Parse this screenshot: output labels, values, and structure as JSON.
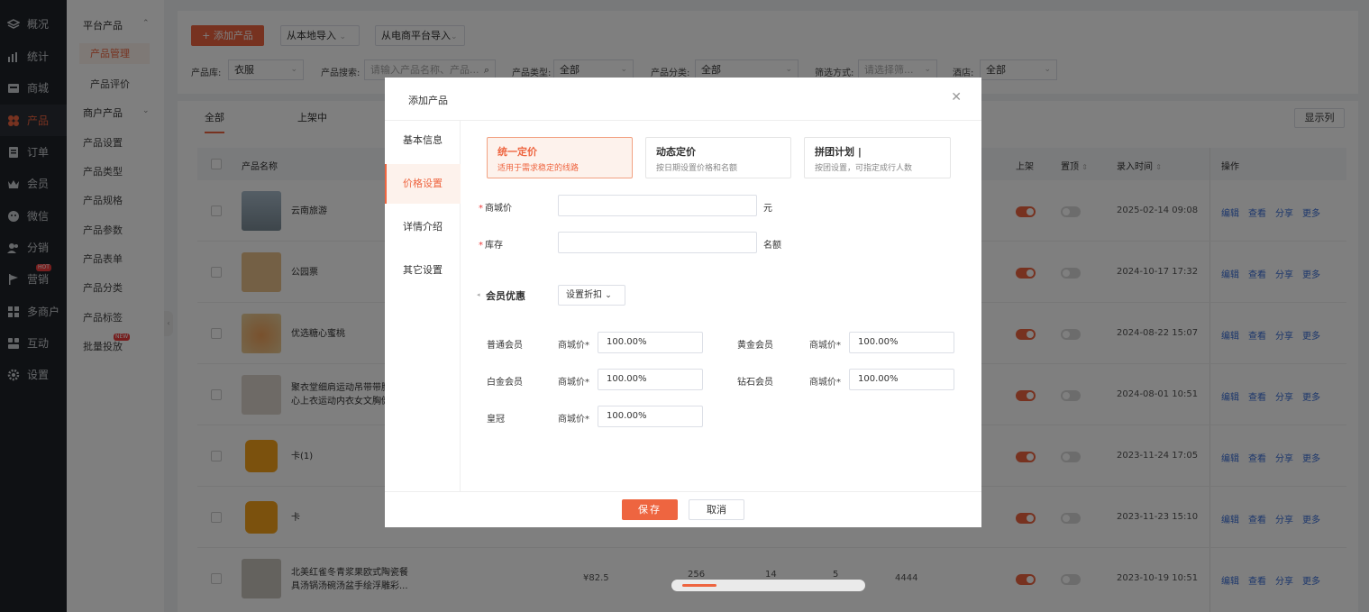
{
  "nav": [
    {
      "label": "概况",
      "icon": "layers-icon"
    },
    {
      "label": "统计",
      "icon": "chart-icon"
    },
    {
      "label": "商城",
      "icon": "store-icon"
    },
    {
      "label": "产品",
      "icon": "grid-icon",
      "active": true
    },
    {
      "label": "订单",
      "icon": "order-icon"
    },
    {
      "label": "会员",
      "icon": "crown-icon"
    },
    {
      "label": "微信",
      "icon": "wechat-icon"
    },
    {
      "label": "分销",
      "icon": "users-icon"
    },
    {
      "label": "营销",
      "icon": "flag-icon",
      "badge": "HOT"
    },
    {
      "label": "多商户",
      "icon": "merchant-icon"
    },
    {
      "label": "互动",
      "icon": "interact-icon"
    },
    {
      "label": "设置",
      "icon": "gear-icon"
    }
  ],
  "subnav": {
    "group1": "平台产品",
    "items1": [
      "产品管理",
      "产品评价"
    ],
    "group2": "商户产品",
    "items2": [
      "产品设置",
      "产品类型",
      "产品规格",
      "产品参数",
      "产品表单",
      "产品分类",
      "产品标签",
      "批量投放"
    ],
    "new_badge": "NEW"
  },
  "toolbar": {
    "add": "+ 添加产品",
    "import_local": "从本地导入",
    "import_platform": "从电商平台导入"
  },
  "filters": {
    "lib_label": "产品库:",
    "lib_value": "衣服",
    "search_label": "产品搜索:",
    "search_placeholder": "请输入产品名称、产品...",
    "type_label": "产品类型:",
    "type_value": "全部",
    "cat_label": "产品分类:",
    "cat_value": "全部",
    "filter_label": "筛选方式:",
    "filter_placeholder": "请选择筛...",
    "hotel_label": "酒店:",
    "hotel_value": "全部"
  },
  "tabs": [
    "全部",
    "上架中"
  ],
  "show_columns": "显示列",
  "table": {
    "headers": {
      "name": "产品名称",
      "on_shelf": "上架",
      "pin": "置顶",
      "time": "录入时间",
      "ops": "操作"
    },
    "actions": [
      "编辑",
      "查看",
      "分享",
      "更多"
    ],
    "rows": [
      {
        "name": "云南旅游",
        "time": "2025-02-14 09:08"
      },
      {
        "name": "公园票",
        "time": "2024-10-17 17:32"
      },
      {
        "name": "优选糖心蜜桃",
        "time": "2024-08-22 15:07"
      },
      {
        "name": "聚衣堂细肩运动吊带带胸",
        "name2": "心上衣运动内衣女文胸健",
        "time": "2024-08-01 10:51"
      },
      {
        "name": "卡(1)",
        "time": "2023-11-24 17:05"
      },
      {
        "name": "卡",
        "time": "2023-11-23 15:10"
      },
      {
        "name": "北美红雀冬青浆果欧式陶瓷餐",
        "name2": "具汤锅汤碗汤盆手绘浮雕彩...",
        "time": "2023-10-19 10:51",
        "price": "¥82.5",
        "v1": "256",
        "v2": "14",
        "v3": "5",
        "v4": "4444"
      }
    ]
  },
  "modal": {
    "title": "添加产品",
    "sidebar": [
      "基本信息",
      "价格设置",
      "详情介绍",
      "其它设置"
    ],
    "pricing_cards": [
      {
        "title": "统一定价",
        "desc": "适用于需求稳定的线路"
      },
      {
        "title": "动态定价",
        "desc": "按日期设置价格和名额"
      },
      {
        "title": "拼团计划 |",
        "desc": "按团设置，可指定成行人数"
      }
    ],
    "mall_price_label": "商城价",
    "mall_price_unit": "元",
    "stock_label": "库存",
    "stock_unit": "名额",
    "member_title": "会员优惠",
    "discount_btn": "设置折扣",
    "levels": [
      {
        "name": "普通会员",
        "label": "商城价*",
        "value": "100.00%"
      },
      {
        "name": "黄金会员",
        "label": "商城价*",
        "value": "100.00%"
      },
      {
        "name": "白金会员",
        "label": "商城价*",
        "value": "100.00%"
      },
      {
        "name": "钻石会员",
        "label": "商城价*",
        "value": "100.00%"
      },
      {
        "name": "皇冠",
        "label": "商城价*",
        "value": "100.00%"
      }
    ],
    "save": "保存",
    "cancel": "取消"
  },
  "colors": {
    "accent": "#ee6540",
    "nav_bg": "#1f2329",
    "link": "#3a6fd8"
  }
}
